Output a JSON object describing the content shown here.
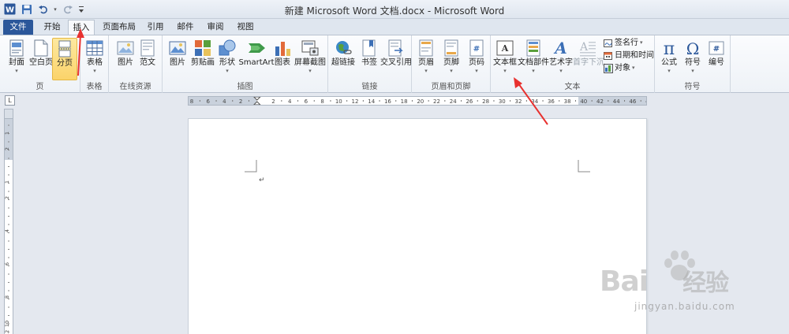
{
  "window": {
    "title": "新建 Microsoft Word 文档.docx - Microsoft Word",
    "qat": [
      "word-app-icon",
      "save-icon",
      "undo-icon",
      "redo-icon",
      "customize-qat-icon"
    ]
  },
  "tabs": [
    {
      "label": "文件"
    },
    {
      "label": "开始"
    },
    {
      "label": "插入"
    },
    {
      "label": "页面布局"
    },
    {
      "label": "引用"
    },
    {
      "label": "邮件"
    },
    {
      "label": "审阅"
    },
    {
      "label": "视图"
    }
  ],
  "ribbon": {
    "groups": {
      "pages": "页",
      "tables": "表格",
      "online": "在线资源",
      "illustrations": "插图",
      "links": "链接",
      "header_footer": "页眉和页脚",
      "text": "文本",
      "symbols": "符号"
    },
    "buttons": {
      "cover": "封面",
      "blank_page": "空白页",
      "page_break": "分页",
      "table": "表格",
      "online_picture": "图片",
      "template": "范文",
      "picture": "图片",
      "clipart": "剪贴画",
      "shapes": "形状",
      "smartart": "SmartArt",
      "chart": "图表",
      "screenshot": "屏幕截图",
      "hyperlink": "超链接",
      "bookmark": "书签",
      "cross_ref": "交叉引用",
      "header": "页眉",
      "footer": "页脚",
      "page_number": "页码",
      "textbox": "文本框",
      "quick_parts": "文档部件",
      "wordart": "艺术字",
      "dropcap": "首字下沉",
      "signature": "签名行",
      "datetime": "日期和时间",
      "object": "对象",
      "equation": "公式",
      "symbol": "符号",
      "numbering": "编号"
    },
    "glyphs": {
      "pi": "π",
      "omega": "Ω",
      "hash": "#",
      "dropdown": "▾",
      "para": "↵"
    }
  },
  "ruler": {
    "h_labels": [
      "8",
      "6",
      "4",
      "2",
      "",
      "2",
      "4",
      "6",
      "8",
      "10",
      "12",
      "14",
      "16",
      "18",
      "20",
      "22",
      "24",
      "26",
      "28",
      "30",
      "32",
      "34",
      "36",
      "38",
      "40",
      "42",
      "44",
      "46",
      "48"
    ],
    "v_labels": [
      "1",
      "2",
      "1",
      "2",
      "4",
      "6",
      "8",
      "10",
      "12"
    ]
  },
  "watermark": {
    "brand": "Bai",
    "brand2": "经验",
    "url": "jingyan.baidu.com"
  },
  "colors": {
    "accent": "#2b579a",
    "pressed": "#fbd36a",
    "arrow": "#e8312f"
  }
}
